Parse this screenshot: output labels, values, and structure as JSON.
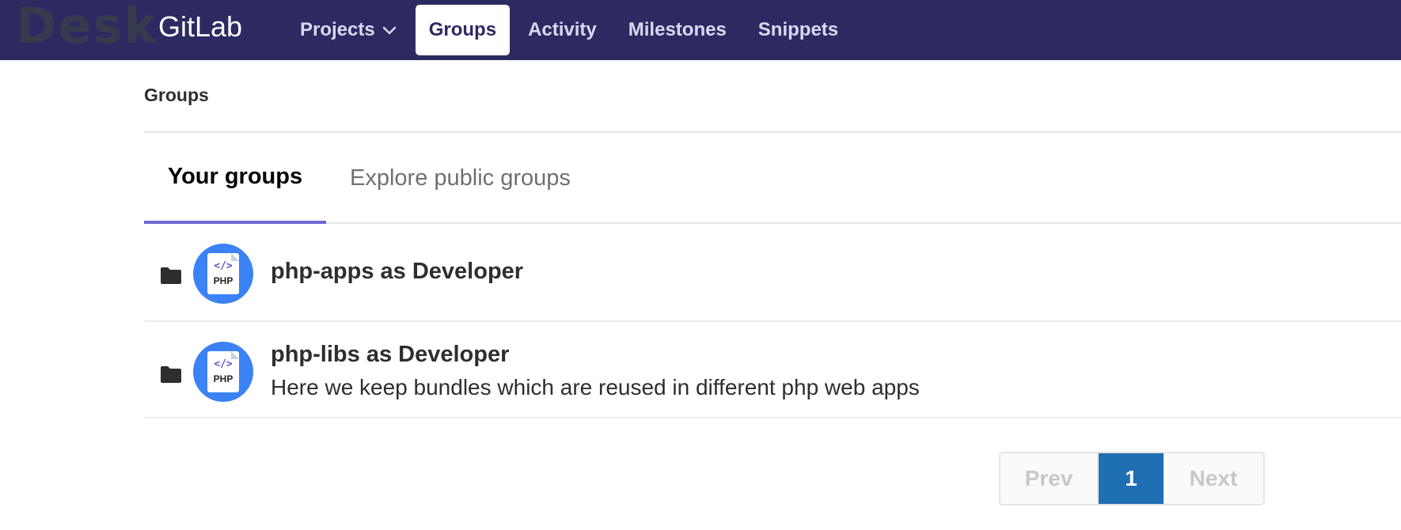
{
  "header": {
    "watermark": "Desk",
    "brand": "GitLab",
    "nav": [
      {
        "label": "Projects",
        "has_dropdown": true,
        "active": false
      },
      {
        "label": "Groups",
        "active": true
      },
      {
        "label": "Activity",
        "active": false
      },
      {
        "label": "Milestones",
        "active": false
      },
      {
        "label": "Snippets",
        "active": false
      }
    ]
  },
  "page": {
    "title": "Groups",
    "tabs": [
      {
        "label": "Your groups",
        "active": true
      },
      {
        "label": "Explore public groups",
        "active": false
      }
    ]
  },
  "groups": [
    {
      "name": "php-apps as Developer",
      "description": "",
      "avatar": {
        "code": "</>",
        "label": "PHP"
      }
    },
    {
      "name": "php-libs as Developer",
      "description": "Here we keep bundles which are reused in different php web apps",
      "avatar": {
        "code": "</>",
        "label": "PHP"
      }
    }
  ],
  "pagination": {
    "prev": "Prev",
    "current": "1",
    "next": "Next"
  },
  "colors": {
    "navbar": "#2c2a61",
    "active_tab_underline": "#6b68d4",
    "avatar_bg": "#3b82f6",
    "current_page": "#1f6fb5"
  }
}
